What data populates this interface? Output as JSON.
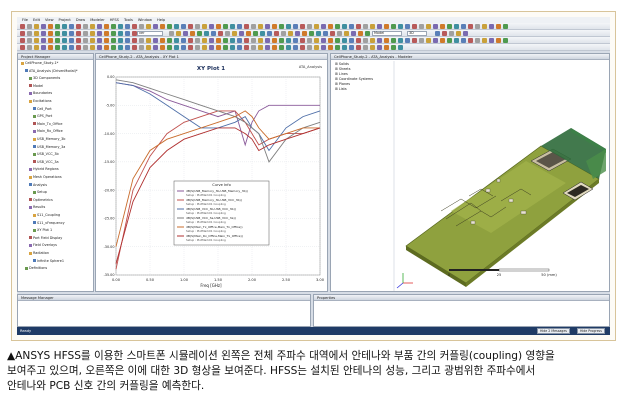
{
  "menu": [
    "File",
    "Edit",
    "View",
    "Project",
    "Draw",
    "Modeler",
    "HFSS",
    "Tools",
    "Window",
    "Help"
  ],
  "toolbar": {
    "combo_material": "ver",
    "combo_model": "Model",
    "combo_dims": "3D"
  },
  "tree": {
    "title": "Project Manager",
    "items": [
      "CellPhone_Study-1*",
      "ATA_Analysis (DrivenModal)*",
      "3D Components",
      "Model",
      "Boundaries",
      "Excitations",
      "Cell_Port",
      "GPS_Port",
      "Main_Tx_Office",
      "Main_Rx_Office",
      "USB_Memory_3b",
      "USB_Memory_3a",
      "USB_VCC_3b",
      "USB_VCC_3a",
      "Hybrid Regions",
      "Mesh Operations",
      "Analysis",
      "Setup",
      "Optimetrics",
      "Results",
      "S11_Coupling",
      "S11_vFrequency",
      "XY Plot 1",
      "Port Field Display",
      "Field Overlays",
      "Radiation",
      "Infinite Sphere1",
      "Definitions"
    ]
  },
  "plot": {
    "window_title": "CellPhone_Study-2 - ATA_Analysis - XY Plot 1",
    "corner_label": "ATA_Analysis",
    "title": "XY Plot 1",
    "xlabel": "Freq [GHz]",
    "legend_title": "Curve Info",
    "legend": [
      {
        "name": "dB(S(USB_Memory_3b,USB_Memory_3b))",
        "setup": "Setup : PlotMark01 Coupling",
        "color": "#8a5a9a"
      },
      {
        "name": "dB(S(USB_Memory_3b,USB_VCC_3b))",
        "setup": "Setup : PlotMark01 Coupling",
        "color": "#c0504d"
      },
      {
        "name": "dB(S(USB_VCC_3b,USB_VCC_3b))",
        "setup": "Setup : PlotMark01 Coupling",
        "color": "#4f6fa8"
      },
      {
        "name": "dB(S(USB_VCC_3a,USB_VCC_3a))",
        "setup": "Setup : PlotMark01 Coupling",
        "color": "#7f7f7f"
      },
      {
        "name": "dB(S(Main_Tx_Office,Main_Tx_Office))",
        "setup": "Setup : PlotMark01 Coupling",
        "color": "#c96c2c"
      },
      {
        "name": "dB(S(Main_Rx_Office,Main_Tx_Office))",
        "setup": "Setup : PlotMark01 Coupling",
        "color": "#b03030"
      }
    ]
  },
  "chart_data": {
    "type": "line",
    "title": "XY Plot 1",
    "xlabel": "Freq [GHz]",
    "ylabel": "",
    "xlim": [
      0.0,
      3.0
    ],
    "ylim": [
      -35,
      0
    ],
    "x_ticks": [
      "0.00",
      "0.50",
      "1.00",
      "1.50",
      "2.00",
      "2.50",
      "3.00"
    ],
    "y_ticks": [
      "0.00",
      "-5.00",
      "-10.00",
      "-15.00",
      "-20.00",
      "-25.00",
      "-30.00",
      "-35.00"
    ],
    "x": [
      0.0,
      0.25,
      0.5,
      0.75,
      1.0,
      1.25,
      1.5,
      1.75,
      1.9,
      2.0,
      2.1,
      2.25,
      2.5,
      2.75,
      3.0
    ],
    "series": [
      {
        "name": "dB(S(USB_Memory_3b,USB_Memory_3b))",
        "color": "#8a5a9a",
        "values": [
          -1,
          -1.5,
          -2.5,
          -4,
          -5,
          -6,
          -7,
          -6,
          -12,
          -8,
          -6,
          -5,
          -5,
          -5,
          -5
        ]
      },
      {
        "name": "dB(S(USB_Memory_3b,USB_VCC_3b))",
        "color": "#c0504d",
        "values": [
          -34,
          -20,
          -14,
          -10,
          -8,
          -7,
          -6,
          -6,
          -8,
          -10,
          -12,
          -11,
          -10,
          -10,
          -9
        ]
      },
      {
        "name": "dB(S(USB_VCC_3b,USB_VCC_3b))",
        "color": "#4f6fa8",
        "values": [
          -1,
          -1.5,
          -3,
          -5,
          -7,
          -9,
          -9,
          -8,
          -7,
          -9,
          -10,
          -13,
          -9,
          -7,
          -6
        ]
      },
      {
        "name": "dB(S(USB_VCC_3a,USB_VCC_3a))",
        "color": "#7f7f7f",
        "values": [
          -0.5,
          -1,
          -2,
          -3,
          -4,
          -5,
          -6,
          -7,
          -8,
          -9,
          -10,
          -15,
          -11,
          -9,
          -8
        ]
      },
      {
        "name": "dB(S(Main_Tx_Office,Main_Tx_Office))",
        "color": "#c96c2c",
        "values": [
          -30,
          -18,
          -13,
          -11,
          -10,
          -9,
          -8,
          -7,
          -6,
          -7,
          -9,
          -11,
          -10,
          -9,
          -9
        ]
      },
      {
        "name": "dB(S(Main_Rx_Office,Main_Tx_Office))",
        "color": "#b03030",
        "values": [
          -33,
          -22,
          -16,
          -13,
          -11,
          -10,
          -9,
          -9,
          -10,
          -11,
          -13,
          -12,
          -11,
          -10,
          -9
        ]
      }
    ]
  },
  "model": {
    "window_title": "CellPhone_Study-2 - ATA_Analysis - Modeler",
    "tree_items": [
      "Solids",
      "Sheets",
      "Lines",
      "Coordinate Systems",
      "Planes",
      "Lists"
    ],
    "scale_labels": [
      "0",
      "25",
      "50 (mm)"
    ]
  },
  "message_title": "Message Manager",
  "properties_title": "Properties",
  "status": {
    "text": "Ready",
    "btn_messages": "Hide 2 Messages",
    "btn_progress": "Hide Progress"
  },
  "caption": {
    "line1": "▲ANSYS HFSS를 이용한 스마트폰 시뮬레이션 왼쪽은 전체 주파수 대역에서 안테나와 부품 간의 커플링(coupling) 영향을",
    "line2": "보여주고 있으며, 오른쪽은 이에 대한 3D 형상을 보여준다. HFSS는 설치된 안테나의 성능, 그리고 광범위한 주파수에서",
    "line3": "안테나와 PCB 신호 간의 커플링을 예측한다."
  }
}
